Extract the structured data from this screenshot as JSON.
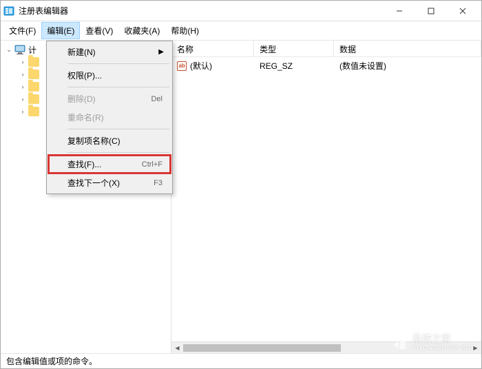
{
  "window": {
    "title": "注册表编辑器",
    "icon": "regedit-icon"
  },
  "menus": {
    "file": "文件(F)",
    "edit": "编辑(E)",
    "view": "查看(V)",
    "favorites": "收藏夹(A)",
    "help": "帮助(H)"
  },
  "edit_dropdown": {
    "new_item": "新建(N)",
    "permissions": "权限(P)...",
    "delete_label": "删除(D)",
    "delete_shortcut": "Del",
    "rename": "重命名(R)",
    "copy_key": "复制项名称(C)",
    "find_label": "查找(F)...",
    "find_shortcut": "Ctrl+F",
    "find_next_label": "查找下一个(X)",
    "find_next_shortcut": "F3"
  },
  "tree": {
    "root": "计",
    "child0": "",
    "child1": "",
    "child2": "",
    "child3": "",
    "child4": ""
  },
  "list": {
    "headers": {
      "name": "名称",
      "type": "类型",
      "data": "数据"
    },
    "rows": [
      {
        "name": "(默认)",
        "type": "REG_SZ",
        "data": "(数值未设置)"
      }
    ]
  },
  "statusbar": {
    "text": "包含编辑值或项的命令。"
  },
  "watermark": {
    "main": "系统之家",
    "sub": "XITONGZHIJIA.NET"
  }
}
